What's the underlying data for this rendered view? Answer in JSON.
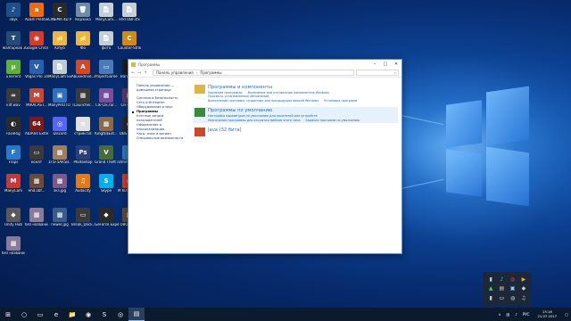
{
  "desktop": {
    "icons": [
      {
        "label": "Звук",
        "color": "#1e4f8a",
        "glyph": "♪"
      },
      {
        "label": "Avast Premier",
        "color": "#e86d14",
        "glyph": "a"
      },
      {
        "label": "CINEMA 4D R14 64BIT",
        "color": "#2a2a2a",
        "glyph": "C"
      },
      {
        "label": "Корзина",
        "color": "#6e8ca8",
        "glyph": "🗑"
      },
      {
        "label": "ManyCam...",
        "color": "#c6cfd8",
        "glyph": "📄"
      },
      {
        "label": "ehd OBF.sfx",
        "color": "#c6cfd8",
        "glyph": "📄"
      },
      {
        "label": "TeamSpeak 3 Client",
        "color": "#244a78",
        "glyph": "T"
      },
      {
        "label": "Google Chrome",
        "color": "#d23c2e",
        "glyph": "◉"
      },
      {
        "label": "Юпуб",
        "color": "#e8b64a",
        "glyph": "📁"
      },
      {
        "label": "Фо",
        "color": "#e8b64a",
        "glyph": "📁"
      },
      {
        "label": "фото",
        "color": "#c6cfd8",
        "glyph": "📄"
      },
      {
        "label": "Counter-Strike Global Offensive",
        "color": "#d08a16",
        "glyph": "C"
      },
      {
        "label": "uTorrent",
        "color": "#5fae3a",
        "glyph": "µ"
      },
      {
        "label": "Vegas Pro 14.0 (64-bit)",
        "color": "#2a5fae",
        "glyph": "V"
      },
      {
        "label": "ManyCam Ext 5.3",
        "color": "#bfc9d4",
        "glyph": "📄"
      },
      {
        "label": "Abusedrive...",
        "color": "#d04a2a",
        "glyph": "A"
      },
      {
        "label": "ProjectGame...",
        "color": "#4a7ab8",
        "glyph": "▭"
      },
      {
        "label": "Bandicam",
        "color": "#1d1d1d",
        "glyph": "B"
      },
      {
        "label": "kitf.wav",
        "color": "#3a3a3a",
        "glyph": "≈"
      },
      {
        "label": "MIRACAST...",
        "color": "#c04a3a",
        "glyph": "M"
      },
      {
        "label": "ManyPROTO Recorder",
        "color": "#2e6fbf",
        "glyph": "▣"
      },
      {
        "label": "TLauncher...",
        "color": "#3a3a3a",
        "glyph": "▦"
      },
      {
        "label": "Clk-Clk.rar...",
        "color": "#7a4c9e",
        "glyph": "▦"
      },
      {
        "label": "Clk-Cell...",
        "color": "#5a3a6e",
        "glyph": "▦"
      },
      {
        "label": "FaceRig",
        "color": "#2b2b2b",
        "glyph": "◐"
      },
      {
        "label": "AIDA64 Extreme",
        "color": "#7a1a1a",
        "glyph": "64"
      },
      {
        "label": "Discord",
        "color": "#5865f2",
        "glyph": "◎"
      },
      {
        "label": "стрим.txt",
        "color": "#e0e0e0",
        "glyph": "≡"
      },
      {
        "label": "Kingf$$Ext...",
        "color": "#8a6a4a",
        "glyph": "▩"
      },
      {
        "label": "OBS Studio",
        "color": "#2a2a2a",
        "glyph": "●"
      },
      {
        "label": "Fraps",
        "color": "#2a78c8",
        "glyph": "F"
      },
      {
        "label": "конат",
        "color": "#3a3a3a",
        "glyph": "▭"
      },
      {
        "label": "1F5F5AR5B...",
        "color": "#9a8060",
        "glyph": "▩"
      },
      {
        "label": "Photoshop",
        "color": "#2a3f7a",
        "glyph": "Ps"
      },
      {
        "label": "Grand Theft Auto V",
        "color": "#4a6a3a",
        "glyph": "V"
      },
      {
        "label": "VimeWorld...",
        "color": "#2a7ab8",
        "glyph": "✦"
      },
      {
        "label": "ManyCam",
        "color": "#c23a3a",
        "glyph": "M"
      },
      {
        "label": "ehd.obf...",
        "color": "#6a4a3a",
        "glyph": "▩"
      },
      {
        "label": "экз.jpg",
        "color": "#7a5a8a",
        "glyph": "▩"
      },
      {
        "label": "Audacity",
        "color": "#e07a1a",
        "glyph": "♫"
      },
      {
        "label": "Skype",
        "color": "#00aff0",
        "glyph": "S"
      },
      {
        "label": "M 6050770...",
        "color": "#d23c2e",
        "glyph": "◉"
      },
      {
        "label": "Unity Hub",
        "color": "#5a5a5a",
        "glyph": "◆"
      },
      {
        "label": "без названия.png",
        "color": "#8a7a9a",
        "glyph": "▩"
      },
      {
        "label": "newer.jpg",
        "color": "#3a5a8a",
        "glyph": "▩"
      },
      {
        "label": "Break_Dock...",
        "color": "#3a3a3a",
        "glyph": "▭"
      },
      {
        "label": "GeForce Experience",
        "color": "#2a2a2a",
        "glyph": "◆"
      },
      {
        "label": "ГОВОРЯЩИЙ КОТ СТРИМ",
        "color": "#6a4a3a",
        "glyph": "▩"
      },
      {
        "label": "без названия.png",
        "color": "#8a7a9a",
        "glyph": "▩"
      }
    ]
  },
  "window": {
    "title": "Программы",
    "breadcrumb": [
      "Панель управления",
      "Программы"
    ],
    "search_placeholder": "",
    "sidebar": [
      "Панель управления —",
      "домашняя страница",
      "",
      "Система и безопасность",
      "Сеть и Интернет",
      "Оборудование и звук",
      "Программы",
      "Учетные записи",
      "пользователей",
      "Оформление и",
      "персонализация",
      "Часы, язык и регион",
      "Специальные возможности"
    ],
    "current_index": 6,
    "categories": [
      {
        "title": "Программы и компоненты",
        "icon_color": "#d9b54a",
        "highlight": false,
        "links": [
          [
            "Удаление программы",
            "Включение или отключение компонентов Windows"
          ],
          [
            "Просмотр установленных обновлений"
          ],
          [
            "Выполнение программ, созданных для предыдущих версий Windows",
            "Установка программ"
          ]
        ]
      },
      {
        "title": "Программы по умолчанию",
        "icon_color": "#3a8a3a",
        "highlight": true,
        "links": [
          [
            "Настройка параметров по умолчанию для носителей или устройств"
          ],
          [
            "Назначение программы для открытия файлов этого типа",
            "Задание программ по умолчанию"
          ]
        ]
      },
      {
        "title": "Java (32 бита)",
        "icon_color": "#c84a2a",
        "highlight": false,
        "links": []
      }
    ]
  },
  "taskbar": {
    "start_glyph": "⊞",
    "items": [
      {
        "glyph": "○",
        "name": "search"
      },
      {
        "glyph": "▭",
        "name": "task-view"
      },
      {
        "glyph": "e",
        "name": "edge"
      },
      {
        "glyph": "📁",
        "name": "explorer"
      },
      {
        "glyph": "◉",
        "name": "chrome"
      },
      {
        "glyph": "S",
        "name": "skype"
      },
      {
        "glyph": "◎",
        "name": "discord"
      },
      {
        "glyph": "▤",
        "name": "control-panel"
      }
    ],
    "active_index": 7,
    "lang": "РУС",
    "time": "13:16",
    "date": "21.07.2017"
  },
  "tray_popup": {
    "glyphs": [
      "▮",
      "♪",
      "◎",
      "▶",
      "▲",
      "▤",
      "▣",
      "◆",
      "▮",
      "▭",
      "◍",
      "♫"
    ]
  }
}
